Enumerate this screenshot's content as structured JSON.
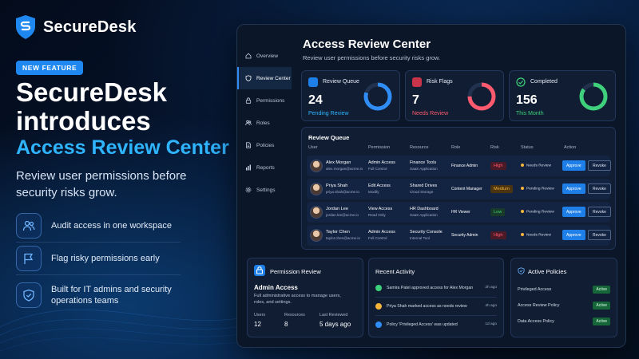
{
  "brand": {
    "name": "SecureDesk"
  },
  "hero": {
    "badge": "NEW FEATURE",
    "title": "SecureDesk introduces",
    "accent": "Access Review Center",
    "subtitle": "Review user permissions before security risks grow."
  },
  "features": [
    {
      "icon": "users-icon",
      "text": "Audit access in one workspace"
    },
    {
      "icon": "flag-icon",
      "text": "Flag risky permissions early"
    },
    {
      "icon": "shield-check-icon",
      "text": "Built for IT admins and security operations teams"
    }
  ],
  "sidebar": {
    "items": [
      {
        "icon": "home-icon",
        "label": "Overview",
        "active": false
      },
      {
        "icon": "shield-icon",
        "label": "Review Center",
        "active": true
      },
      {
        "icon": "lock-icon",
        "label": "Permissions",
        "active": false
      },
      {
        "icon": "users-icon",
        "label": "Roles",
        "active": false
      },
      {
        "icon": "document-icon",
        "label": "Policies",
        "active": false
      },
      {
        "icon": "bar-chart-icon",
        "label": "Reports",
        "active": false
      },
      {
        "icon": "gear-icon",
        "label": "Settings",
        "active": false
      }
    ]
  },
  "page": {
    "title": "Access Review Center",
    "subtitle": "Review user permissions before security risks grow."
  },
  "stats": [
    {
      "title": "Review Queue",
      "value": "24",
      "label": "Pending Review",
      "color": "#2f8df5",
      "fraction": 0.8,
      "icon": "clipboard-icon"
    },
    {
      "title": "Risk Flags",
      "value": "7",
      "label": "Needs Review",
      "color": "#ff5a6e",
      "fraction": 0.75,
      "icon": "flag-icon"
    },
    {
      "title": "Completed",
      "value": "156",
      "label": "This Month",
      "color": "#3ed07a",
      "fraction": 0.85,
      "icon": "check-circle-icon"
    }
  ],
  "queue": {
    "title": "Review Queue",
    "columns": {
      "user": "User",
      "permission": "Permission",
      "resource": "Resource",
      "role": "Role",
      "risk": "Risk",
      "status": "Status",
      "action": "Action"
    },
    "approve_label": "Approve",
    "revoke_label": "Revoke",
    "rows": [
      {
        "name": "Alex Morgan",
        "email": "alex.morgan@acme.io",
        "permission": "Admin Access",
        "permission_sub": "Full Control",
        "resource": "Finance Tools",
        "resource_sub": "SaaS Application",
        "role": "Finance Admin",
        "risk": "High",
        "risk_level": "high",
        "status": "Needs Review"
      },
      {
        "name": "Priya Shah",
        "email": "priya.shah@acme.io",
        "permission": "Edit Access",
        "permission_sub": "Modify",
        "resource": "Shared Drives",
        "resource_sub": "Cloud Storage",
        "role": "Content Manager",
        "risk": "Medium",
        "risk_level": "medium",
        "status": "Pending Review"
      },
      {
        "name": "Jordan Lee",
        "email": "jordan.lee@acme.io",
        "permission": "View Access",
        "permission_sub": "Read Only",
        "resource": "HR Dashboard",
        "resource_sub": "SaaS Application",
        "role": "HR Viewer",
        "risk": "Low",
        "risk_level": "low",
        "status": "Pending Review"
      },
      {
        "name": "Taylor Chen",
        "email": "taylor.chen@acme.io",
        "permission": "Admin Access",
        "permission_sub": "Full Control",
        "resource": "Security Console",
        "resource_sub": "Internal Tool",
        "role": "Security Admin",
        "risk": "High",
        "risk_level": "high",
        "status": "Needs Review"
      }
    ]
  },
  "permission_review": {
    "title": "Permission Review",
    "name": "Admin Access",
    "description": "Full administrative access to manage users, roles, and settings.",
    "stats": [
      {
        "label": "Users",
        "value": "12"
      },
      {
        "label": "Resources",
        "value": "8"
      },
      {
        "label": "Last Reviewed",
        "value": "5 days ago"
      }
    ]
  },
  "activity": {
    "title": "Recent Activity",
    "items": [
      {
        "icon": "check-circle-icon",
        "color": "#3ed07a",
        "text": "Samira Patel approved access for Alex Morgan",
        "time": "2h ago"
      },
      {
        "icon": "clock-icon",
        "color": "#f5b43a",
        "text": "Priya Shah marked access as needs review",
        "time": "4h ago"
      },
      {
        "icon": "info-icon",
        "color": "#2f8df5",
        "text": "Policy 'Privileged Access' was updated",
        "time": "1d ago"
      }
    ]
  },
  "policies": {
    "title": "Active Policies",
    "items": [
      {
        "name": "Privileged Access",
        "status": "Active"
      },
      {
        "name": "Access Review Policy",
        "status": "Active"
      },
      {
        "name": "Data Access Policy",
        "status": "Active"
      }
    ]
  }
}
